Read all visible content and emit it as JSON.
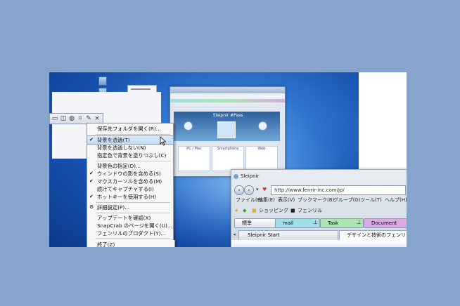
{
  "menu": {
    "items": [
      {
        "label": "保存先フォルダを開く(R)...",
        "checked": false,
        "highlighted": false
      },
      {
        "label": "背景を透過(T)",
        "checked": true,
        "highlighted": true
      },
      {
        "label": "背景を透過しない(N)",
        "checked": false,
        "highlighted": false
      },
      {
        "label": "指定色で背景を塗りつぶし(C)",
        "checked": false,
        "highlighted": false
      },
      {
        "label": "背景色の指定(D)...",
        "checked": false,
        "highlighted": false
      },
      {
        "label": "ウィンドウの影を含める(S)",
        "checked": true,
        "highlighted": false
      },
      {
        "label": "マウスカーソルを含める(M)",
        "checked": true,
        "highlighted": false
      },
      {
        "label": "続けてキャプチャする(I)",
        "checked": false,
        "highlighted": false
      },
      {
        "label": "ホットキーを使用する(H)",
        "checked": true,
        "highlighted": false
      },
      {
        "label": "詳細設定(P)...",
        "checked": false,
        "highlighted": false
      },
      {
        "label": "アップデートを確認(X)",
        "checked": false,
        "highlighted": false
      },
      {
        "label": "SnapCrab のページを開く(U)...",
        "checked": false,
        "highlighted": false
      },
      {
        "label": "フェンリルのプロダクト(Y)...",
        "checked": false,
        "highlighted": false
      },
      {
        "label": "終了(Z)",
        "checked": false,
        "highlighted": false
      }
    ]
  },
  "browser": {
    "title": "Sleipnir",
    "address": "http://www.fenrir-inc.com/jp/",
    "menubar": [
      "ファイル(F)",
      "編集(E)",
      "表示(V)",
      "ブックマーク(B)",
      "グループ(G)",
      "ツール(T)",
      "ヘルプ(H)"
    ],
    "bookmarks": [
      "ショッピング",
      "フェンリル"
    ],
    "tab_groups": [
      "標準",
      "mail",
      "Task",
      "Document"
    ],
    "tabs": [
      "Sleipnir Start",
      "デザインと技術のフェンリル"
    ]
  },
  "thumbnail": {
    "banner_text": "Sleipnir #Pass",
    "cards": [
      "PC / Mac",
      "Smartphone",
      "Web"
    ]
  },
  "colors": {
    "background": "#87a4cd",
    "highlight": "#c2dcf7",
    "group_mail": "#9fe0e8",
    "group_task": "#a9e6b0",
    "group_document": "#dca9e6"
  }
}
